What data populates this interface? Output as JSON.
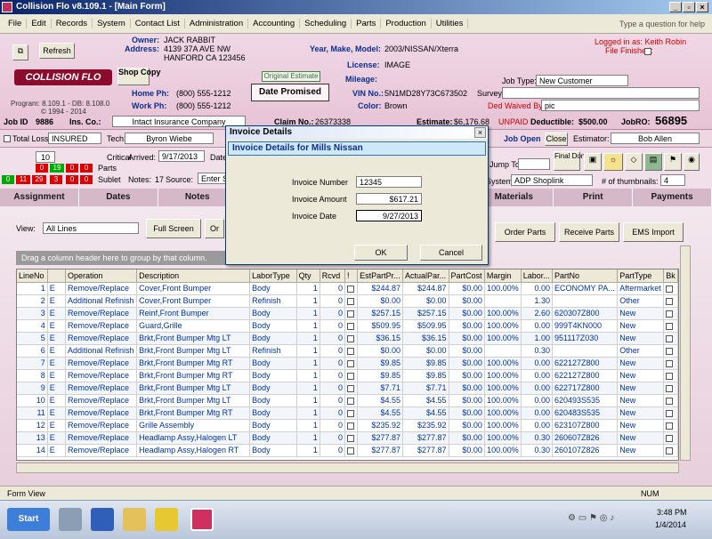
{
  "window": {
    "title": "Collision Flo v8.109.1 - [Main Form]"
  },
  "menu": [
    "File",
    "Edit",
    "Records",
    "System",
    "Contact List",
    "Administration",
    "Accounting",
    "Scheduling",
    "Parts",
    "Production",
    "Utilities"
  ],
  "help_placeholder": "Type a question for help",
  "header": {
    "refresh": "Refresh",
    "logo": "COLLISION FLO",
    "shop_btn": "Shop Copy",
    "program": "Program: 8.109.1 - DB: 8.108.0",
    "copyright": "© 1994 - 2014",
    "owner_lbl": "Owner:",
    "owner": "JACK RABBIT",
    "address_lbl": "Address:",
    "address1": "4139 37A AVE NW",
    "address2": "HANFORD CA 123456",
    "home_lbl": "Home Ph:",
    "home": "(800) 555-1212",
    "work_lbl": "Work Ph:",
    "work": "(800) 555-1212",
    "original_estimate": "Original Estimate",
    "date_promised": "Date Promised",
    "ymm_lbl": "Year, Make, Model:",
    "ymm": "2003/NISSAN/Xterra",
    "license_lbl": "License:",
    "license": "IMAGE",
    "mileage_lbl": "Mileage:",
    "mileage": "",
    "vin_lbl": "VIN No.:",
    "vin": "5N1MD28Y73C673502",
    "color_lbl": "Color:",
    "color": "Brown",
    "logged_in": "Logged in as: Keith Robin",
    "file_finished": "File Finished:",
    "job_type_lbl": "Job Type:",
    "job_type": "New Customer",
    "survey_lbl": "Survey:",
    "ded_waived_lbl": "Ded Waived By:",
    "ded_waived": "pic",
    "jobid_lbl": "Job ID",
    "jobid": "9886",
    "ins_lbl": "Ins. Co.:",
    "ins": "Intact Insurance Company",
    "claim_lbl": "Claim No.:",
    "claim": "26373338",
    "estimate_lbl": "Estimate:",
    "estimate": "$6,176.68",
    "unpaid": "UNPAID",
    "deductible_lbl": "Deductible:",
    "deductible": "$500.00",
    "jobro_lbl": "JobRO:",
    "jobro": "56895"
  },
  "status": {
    "total_loss": "Total Loss",
    "insured": "INSURED",
    "tech_lbl": "Tech:",
    "tech": "Byron Wiebe",
    "job_open": "Job Open",
    "close": "Close",
    "estimator_lbl": "Estimator:",
    "estimator": "Bob Allen"
  },
  "mid": {
    "count": "10",
    "critical": "Critical",
    "parts": "Parts",
    "sublet": "Sublet",
    "r1": [
      "0",
      "19",
      "0",
      "0"
    ],
    "r2": [
      "0",
      "11",
      "29",
      "3",
      "0",
      "0"
    ],
    "arrived_lbl": "Arrived:",
    "arrived": "9/17/2013",
    "date_lbl": "Date",
    "notes_lbl": "Notes:",
    "notes": "17",
    "source_lbl": "Source:",
    "source": "Enter S",
    "jump_to": "Jump To",
    "final_done": "Final Done!",
    "system_lbl": "System:",
    "system": "ADP Shoplink",
    "thumbs_lbl": "# of thumbnails:",
    "thumbs": "4"
  },
  "tabs": [
    "Assignment",
    "Dates",
    "Notes",
    "",
    "",
    "",
    "Materials",
    "Print",
    "Payments"
  ],
  "content": {
    "view_lbl": "View:",
    "view": "All Lines",
    "full_screen": "Full Screen",
    "or": "Or",
    "order_parts": "Order Parts",
    "receive_parts": "Receive Parts",
    "ems_import": "EMS Import",
    "group_hint": "Drag a column header here to group by that column."
  },
  "grid": {
    "columns": [
      "LineNo",
      "",
      "Operation",
      "Description",
      "LaborType",
      "Qty",
      "Rcvd",
      "!",
      "EstPartPr...",
      "ActualPar...",
      "PartCost",
      "Margin",
      "Labor...",
      "PartNo",
      "PartType",
      "Bk"
    ],
    "rows": [
      [
        "1",
        "E",
        "Remove/Replace",
        "Cover,Front Bumper",
        "Body",
        "1",
        "0",
        "",
        "$244.87",
        "$244.87",
        "$0.00",
        "100.00%",
        "0.00",
        "ECONOMY PA...",
        "Aftermarket"
      ],
      [
        "2",
        "E",
        "Additional Refinish",
        "Cover,Front Bumper",
        "Refinish",
        "1",
        "0",
        "",
        "$0.00",
        "$0.00",
        "$0.00",
        "",
        "1.30",
        "",
        "Other"
      ],
      [
        "3",
        "E",
        "Remove/Replace",
        "Reinf,Front Bumper",
        "Body",
        "1",
        "0",
        "",
        "$257.15",
        "$257.15",
        "$0.00",
        "100.00%",
        "2.60",
        "620307Z800",
        "New"
      ],
      [
        "4",
        "E",
        "Remove/Replace",
        "Guard,Grille",
        "Body",
        "1",
        "0",
        "",
        "$509.95",
        "$509.95",
        "$0.00",
        "100.00%",
        "0.00",
        "999T4KN000",
        "New"
      ],
      [
        "5",
        "E",
        "Remove/Replace",
        "Brkt,Front Bumper Mtg  LT",
        "Body",
        "1",
        "0",
        "",
        "$36.15",
        "$36.15",
        "$0.00",
        "100.00%",
        "1.00",
        "951117Z030",
        "New"
      ],
      [
        "6",
        "E",
        "Additional Refinish",
        "Brkt,Front Bumper Mtg  LT",
        "Refinish",
        "1",
        "0",
        "",
        "$0.00",
        "$0.00",
        "$0.00",
        "",
        "0.30",
        "",
        "Other"
      ],
      [
        "7",
        "E",
        "Remove/Replace",
        "Brkt,Front Bumper Mtg  RT",
        "Body",
        "1",
        "0",
        "",
        "$9.85",
        "$9.85",
        "$0.00",
        "100.00%",
        "0.00",
        "622127Z800",
        "New"
      ],
      [
        "8",
        "E",
        "Remove/Replace",
        "Brkt,Front Bumper Mtg  RT",
        "Body",
        "1",
        "0",
        "",
        "$9.85",
        "$9.85",
        "$0.00",
        "100.00%",
        "0.00",
        "622127Z800",
        "New"
      ],
      [
        "9",
        "E",
        "Remove/Replace",
        "Brkt,Front Bumper Mtg  LT",
        "Body",
        "1",
        "0",
        "",
        "$7.71",
        "$7.71",
        "$0.00",
        "100.00%",
        "0.00",
        "622717Z800",
        "New"
      ],
      [
        "10",
        "E",
        "Remove/Replace",
        "Brkt,Front Bumper Mtg  LT",
        "Body",
        "1",
        "0",
        "",
        "$4.55",
        "$4.55",
        "$0.00",
        "100.00%",
        "0.00",
        "620493S535",
        "New"
      ],
      [
        "11",
        "E",
        "Remove/Replace",
        "Brkt,Front Bumper Mtg  RT",
        "Body",
        "1",
        "0",
        "",
        "$4.55",
        "$4.55",
        "$0.00",
        "100.00%",
        "0.00",
        "620483S535",
        "New"
      ],
      [
        "12",
        "E",
        "Remove/Replace",
        "Grille Assembly",
        "Body",
        "1",
        "0",
        "",
        "$235.92",
        "$235.92",
        "$0.00",
        "100.00%",
        "0.00",
        "623107Z800",
        "New"
      ],
      [
        "13",
        "E",
        "Remove/Replace",
        "Headlamp Assy,Halogen  LT",
        "Body",
        "1",
        "0",
        "",
        "$277.87",
        "$277.87",
        "$0.00",
        "100.00%",
        "0.30",
        "260607Z826",
        "New"
      ],
      [
        "14",
        "E",
        "Remove/Replace",
        "Headlamp Assy,Halogen  RT",
        "Body",
        "1",
        "0",
        "",
        "$277.87",
        "$277.87",
        "$0.00",
        "100.00%",
        "0.30",
        "260107Z826",
        "New"
      ]
    ]
  },
  "dialog": {
    "title": "Invoice Details",
    "subtitle": "Invoice Details for Mills Nissan",
    "inv_num_lbl": "Invoice Number",
    "inv_num": "12345",
    "inv_amt_lbl": "Invoice Amount",
    "inv_amt": "$617.21",
    "inv_date_lbl": "Invoice Date",
    "inv_date": "9/27/2013",
    "ok": "OK",
    "cancel": "Cancel"
  },
  "statusbar": {
    "left": "Form View",
    "right": "NUM"
  },
  "taskbar": {
    "start": "Start",
    "time": "3:48 PM",
    "date": "1/4/2014"
  }
}
